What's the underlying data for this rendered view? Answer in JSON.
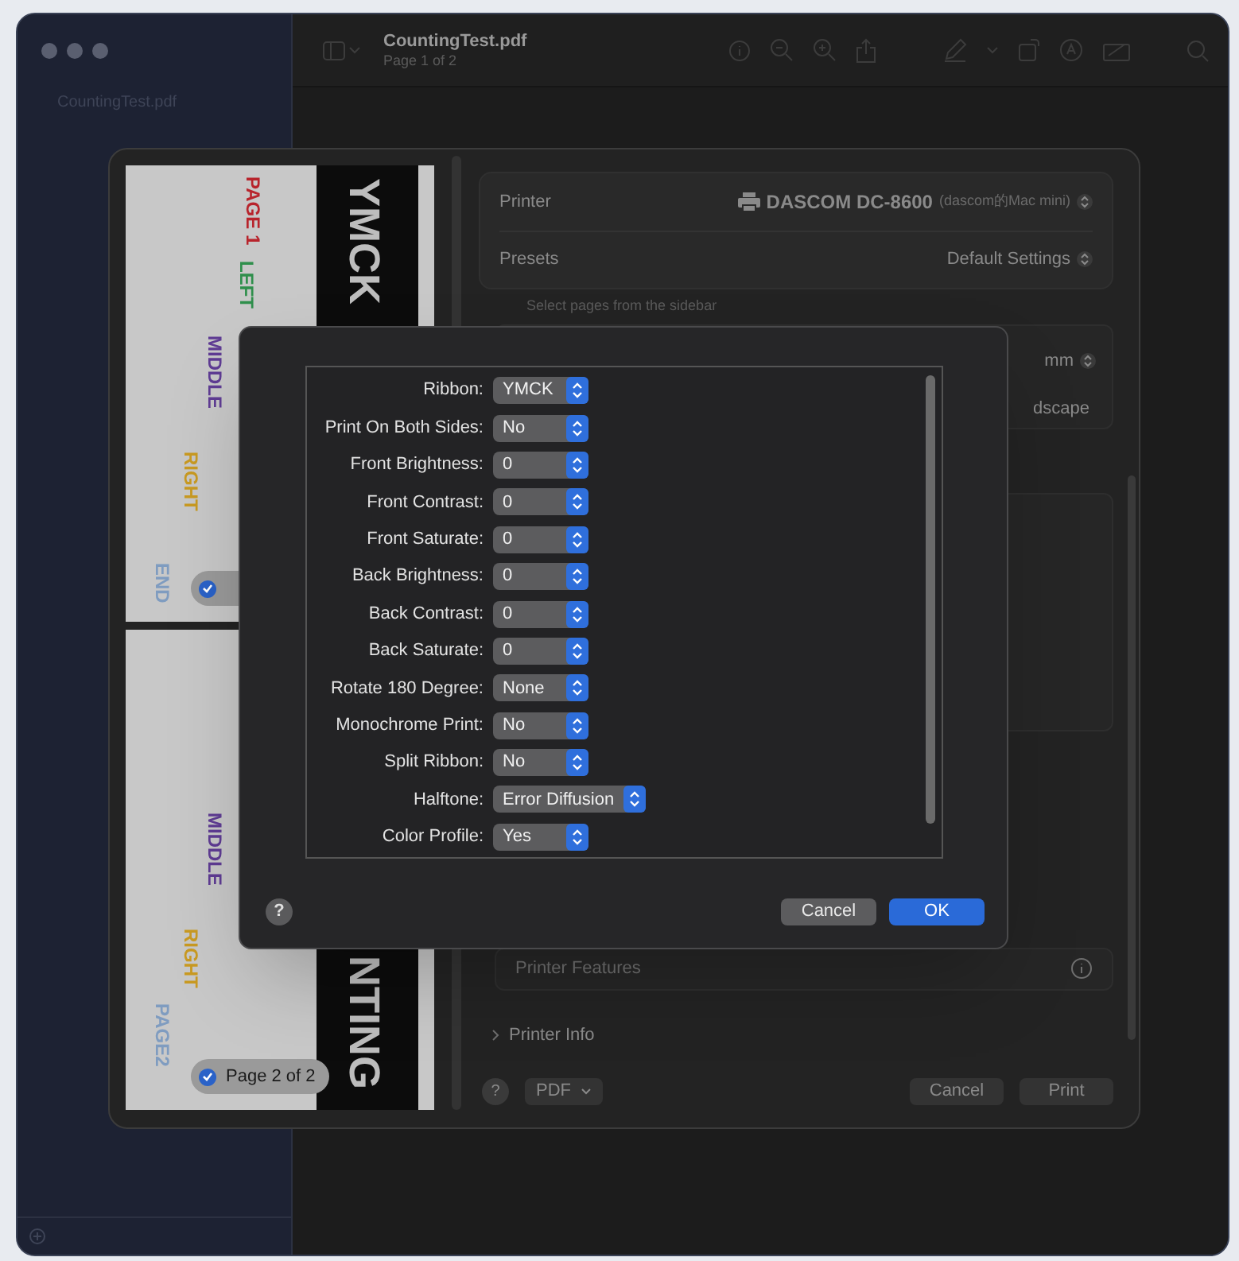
{
  "window": {
    "sidebar_title": "CountingTest.pdf",
    "title": "CountingTest.pdf",
    "subtitle": "Page 1 of 2"
  },
  "preview_pages": [
    {
      "banner": "YMCK",
      "labels": [
        {
          "text": "PAGE 1",
          "color": "#b8242c"
        },
        {
          "text": "LEFT",
          "color": "#2f8f4c"
        },
        {
          "text": "MIDDLE",
          "color": "#5f3c94"
        },
        {
          "text": "RIGHT",
          "color": "#c99a22"
        },
        {
          "text": "END",
          "color": "#7f9cc0"
        }
      ],
      "selected": true
    },
    {
      "banner": "NTING",
      "labels": [
        {
          "text": "MIDDLE",
          "color": "#5f3c94"
        },
        {
          "text": "RIGHT",
          "color": "#c99a22"
        },
        {
          "text": "PAGE2",
          "color": "#7f9cc0"
        }
      ],
      "selected": true,
      "badge": "Page 2 of 2"
    }
  ],
  "print_panel": {
    "printer": {
      "label": "Printer",
      "value": "DASCOM DC-8600",
      "detail": "(dascom的Mac mini)"
    },
    "presets": {
      "label": "Presets",
      "value": "Default Settings"
    },
    "hint": "Select pages from the sidebar",
    "paper_size": "mm",
    "orientation": "dscape",
    "printer_features": "Printer Features",
    "printer_info": "Printer Info",
    "help_button": "?",
    "pdf_button": "PDF",
    "cancel_button": "Cancel",
    "print_button": "Print"
  },
  "features_dialog": {
    "options": [
      {
        "label": "Ribbon:",
        "value": "YMCK"
      },
      {
        "label": "Print On Both Sides:",
        "value": "No"
      },
      {
        "label": "Front Brightness:",
        "value": "0"
      },
      {
        "label": "Front Contrast:",
        "value": "0"
      },
      {
        "label": "Front Saturate:",
        "value": "0"
      },
      {
        "label": "Back Brightness:",
        "value": "0"
      },
      {
        "label": "Back Contrast:",
        "value": "0"
      },
      {
        "label": "Back Saturate:",
        "value": "0"
      },
      {
        "label": "Rotate 180 Degree:",
        "value": "None"
      },
      {
        "label": "Monochrome Print:",
        "value": "No"
      },
      {
        "label": "Split Ribbon:",
        "value": "No"
      },
      {
        "label": "Halftone:",
        "value": "Error Diffusion"
      },
      {
        "label": "Color Profile:",
        "value": "Yes"
      }
    ],
    "help_button": "?",
    "cancel_button": "Cancel",
    "ok_button": "OK"
  }
}
